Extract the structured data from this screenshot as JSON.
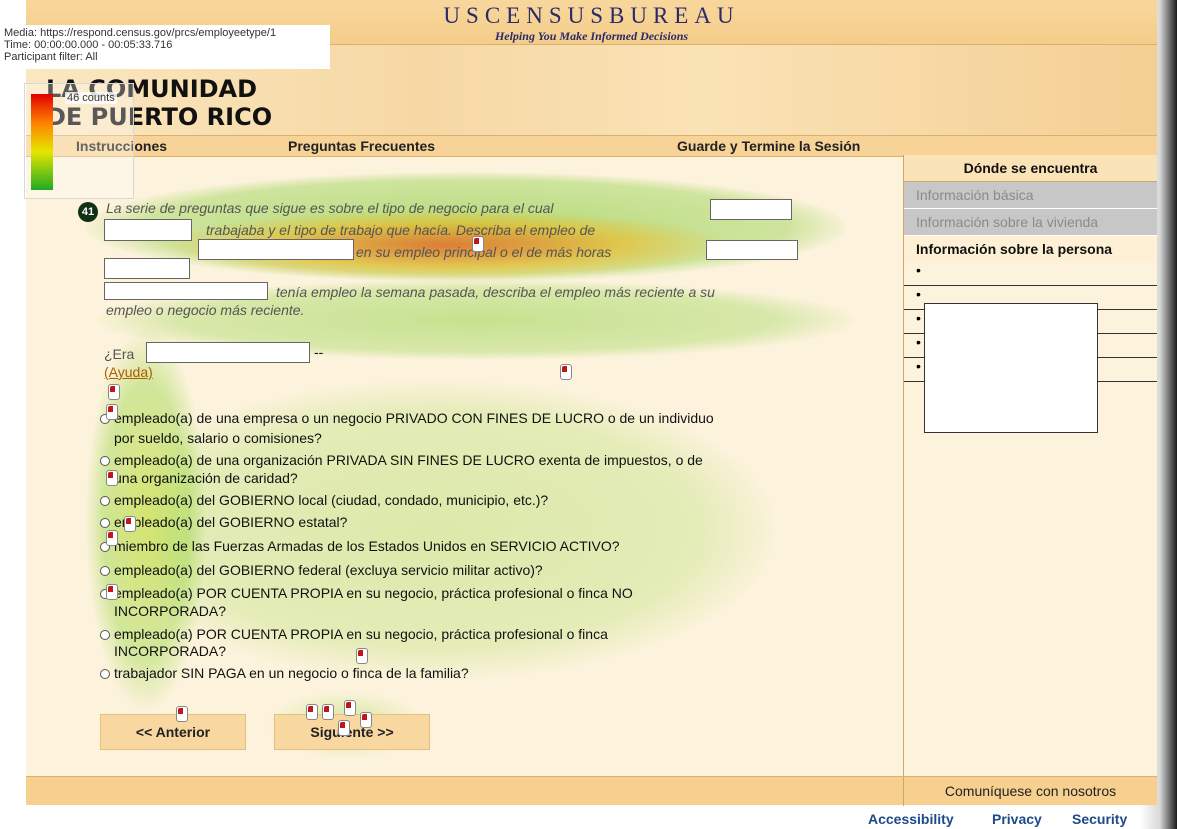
{
  "overlay": {
    "media": "Media: https://respond.census.gov/prcs/employeetype/1",
    "time": "Time: 00:00:00.000 - 00:05:33.716",
    "filter": "Participant filter: All",
    "legend_count": "46 counts"
  },
  "header": {
    "agency": "USCENSUSBUREAU",
    "tagline": "Helping You Make Informed Decisions",
    "brand_line1": "LA COMUNIDAD",
    "brand_line2": "DE PUERTO RICO"
  },
  "nav": {
    "instructions": "Instrucciones",
    "faq": "Preguntas Frecuentes",
    "save_exit": "Guarde y Termine la Sesión"
  },
  "question": {
    "number": "41",
    "line1": "La serie de preguntas que sigue es sobre el tipo de negocio para el cual",
    "line2": "trabajaba y el tipo de trabajo que hacía. Describa el empleo de",
    "line3": "en su empleo principal o el de más horas",
    "line4": "tenía empleo la semana pasada, describa el empleo más reciente a su",
    "line5": "empleo o negocio más reciente.",
    "prompt": "¿Era",
    "prompt_suffix": "--",
    "help": "(Ayuda)"
  },
  "answers": [
    "empleado(a) de una empresa o un negocio PRIVADO CON FINES DE LUCRO o de un individuo",
    "por sueldo, salario o comisiones?",
    "empleado(a) de una organización PRIVADA SIN FINES DE LUCRO exenta de impuestos, o de",
    "una organización de caridad?",
    "empleado(a) del GOBIERNO local (ciudad, condado, municipio, etc.)?",
    "empleado(a) del GOBIERNO estatal?",
    "miembro de las Fuerzas Armadas de los Estados Unidos en SERVICIO ACTIVO?",
    "empleado(a) del GOBIERNO federal (excluya servicio militar activo)?",
    "empleado(a) POR CUENTA PROPIA en su negocio, práctica profesional o finca NO",
    "INCORPORADA?",
    "empleado(a) POR CUENTA PROPIA en su negocio, práctica profesional o finca",
    "INCORPORADA?",
    "trabajador SIN PAGA en un negocio o finca de la familia?"
  ],
  "buttons": {
    "previous": "<<  Anterior",
    "next": "Siguiente  >>"
  },
  "sidebar": {
    "title": "Dónde se encuentra",
    "item1": "Información básica",
    "item2": "Información sobre la vivienda",
    "item3": "Información sobre la persona"
  },
  "footer": {
    "contact": "Comuníquese con nosotros",
    "accessibility": "Accessibility",
    "privacy": "Privacy",
    "security": "Security"
  },
  "colors": {
    "accent": "#f7d398",
    "link": "#1d4a8a",
    "background": "#fdf3dd"
  }
}
